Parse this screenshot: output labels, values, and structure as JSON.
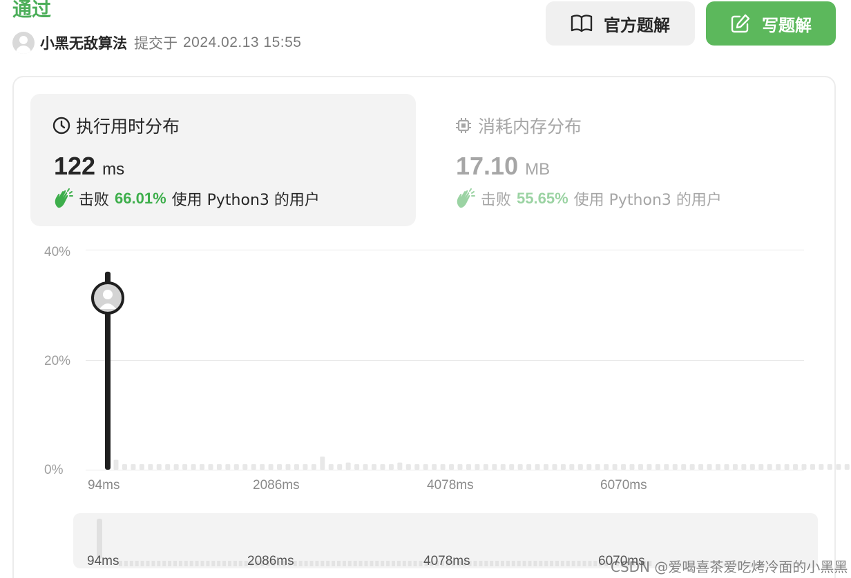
{
  "header": {
    "status": "通过",
    "username": "小黑无敌算法",
    "submit_label": "提交于",
    "submit_time": "2024.02.13 15:55",
    "official_solution_label": "官方题解",
    "write_solution_label": "写题解"
  },
  "colors": {
    "accent_green": "#5cb85c",
    "status_green": "#4cae5a",
    "beat_green": "#3dae4b"
  },
  "runtime_card": {
    "title": "执行用时分布",
    "icon": "clock-icon",
    "value": "122",
    "unit": "ms",
    "beat_prefix": "击败",
    "beat_percent": "66.01%",
    "beat_suffix": "使用 Python3 的用户"
  },
  "memory_card": {
    "title": "消耗内存分布",
    "icon": "chip-icon",
    "value": "17.10",
    "unit": "MB",
    "beat_prefix": "击败",
    "beat_percent": "55.65%",
    "beat_suffix": "使用 Python3 的用户"
  },
  "chart_data": {
    "type": "bar",
    "y_ticks": [
      "40%",
      "20%",
      "0%"
    ],
    "ylim": [
      0,
      40
    ],
    "x_ticks": [
      "94ms",
      "2086ms",
      "4078ms",
      "6070ms"
    ],
    "values": [
      1.8,
      1.0,
      1.0,
      1.0,
      1.0,
      1.0,
      1.0,
      1.0,
      1.0,
      1.0,
      1.0,
      1.0,
      1.0,
      1.0,
      1.0,
      1.0,
      1.0,
      1.0,
      1.0,
      1.0,
      1.0,
      1.0,
      1.0,
      1.0,
      2.4,
      1.0,
      1.0,
      1.3,
      1.0,
      1.0,
      1.0,
      1.0,
      1.0,
      1.3,
      1.0,
      1.0,
      1.0,
      1.0,
      1.0,
      1.0,
      1.0,
      1.0,
      1.0,
      1.0,
      1.0,
      1.0,
      1.0,
      1.0,
      1.0,
      1.0,
      1.0,
      1.0,
      1.0,
      1.0,
      1.0,
      1.0,
      1.0,
      1.0,
      1.0,
      1.0,
      1.0,
      1.0,
      1.0,
      1.0,
      1.0,
      1.0,
      1.0,
      1.0,
      1.0,
      1.0,
      1.0,
      1.0,
      1.0,
      1.0,
      1.0,
      1.0,
      1.0,
      1.0,
      1.0,
      1.0,
      1.0,
      1.0,
      1.0,
      1.0,
      1.0,
      1.0,
      1.0,
      1.0,
      1.0,
      1.0,
      1.0,
      1.0,
      1.0,
      1.0,
      1.0,
      1.0,
      1.0,
      1.0
    ],
    "highlight_value": 36,
    "grid": true
  },
  "range_slider": {
    "x_ticks": [
      "94ms",
      "2086ms",
      "4078ms",
      "6070ms"
    ]
  },
  "watermark": "CSDN @爱喝喜茶爱吃烤冷面的小黑黑"
}
